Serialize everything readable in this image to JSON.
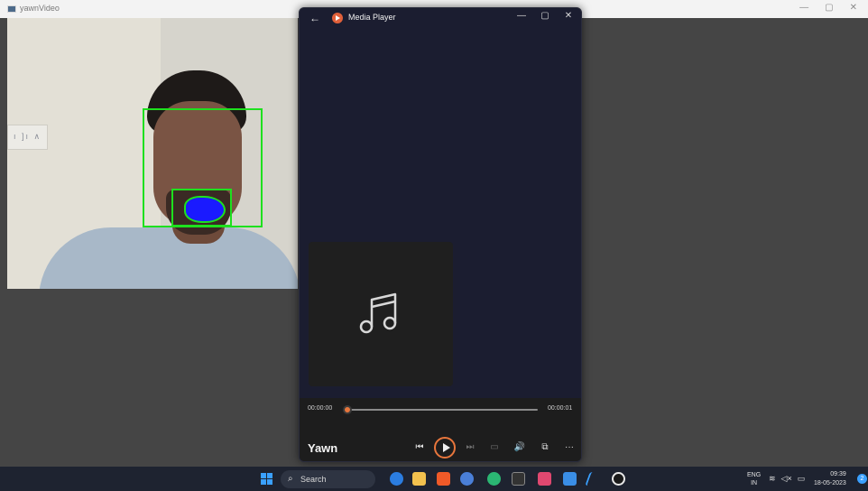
{
  "background_window": {
    "title": "yawnVideo",
    "controls": [
      "—",
      "▢",
      "✕"
    ]
  },
  "video": {
    "wall_switch_text": "ı ]ı ∧",
    "overlay_color": "#1ee01e",
    "mouth_fill_color": "#1a1aff"
  },
  "media_player": {
    "title": "Media Player",
    "back_icon": "←",
    "window_controls": {
      "minimize": "—",
      "maximize": "▢",
      "close": "✕"
    },
    "artwork_icon": "music-note-icon",
    "current_time": "00:00:00",
    "total_time": "00:00:01",
    "progress": 0,
    "song_title": "Yawn",
    "controls": {
      "previous": "⏮",
      "next": "⏭",
      "cast": "▭",
      "volume": "🔊",
      "mini_player": "⧉",
      "more": "···"
    },
    "accent_color": "#e8763c"
  },
  "taskbar": {
    "search_placeholder": "Search",
    "tray": {
      "language_line1": "ENG",
      "language_line2": "IN",
      "time": "09:39",
      "date": "18-05-2023",
      "notification_count": "2"
    }
  }
}
